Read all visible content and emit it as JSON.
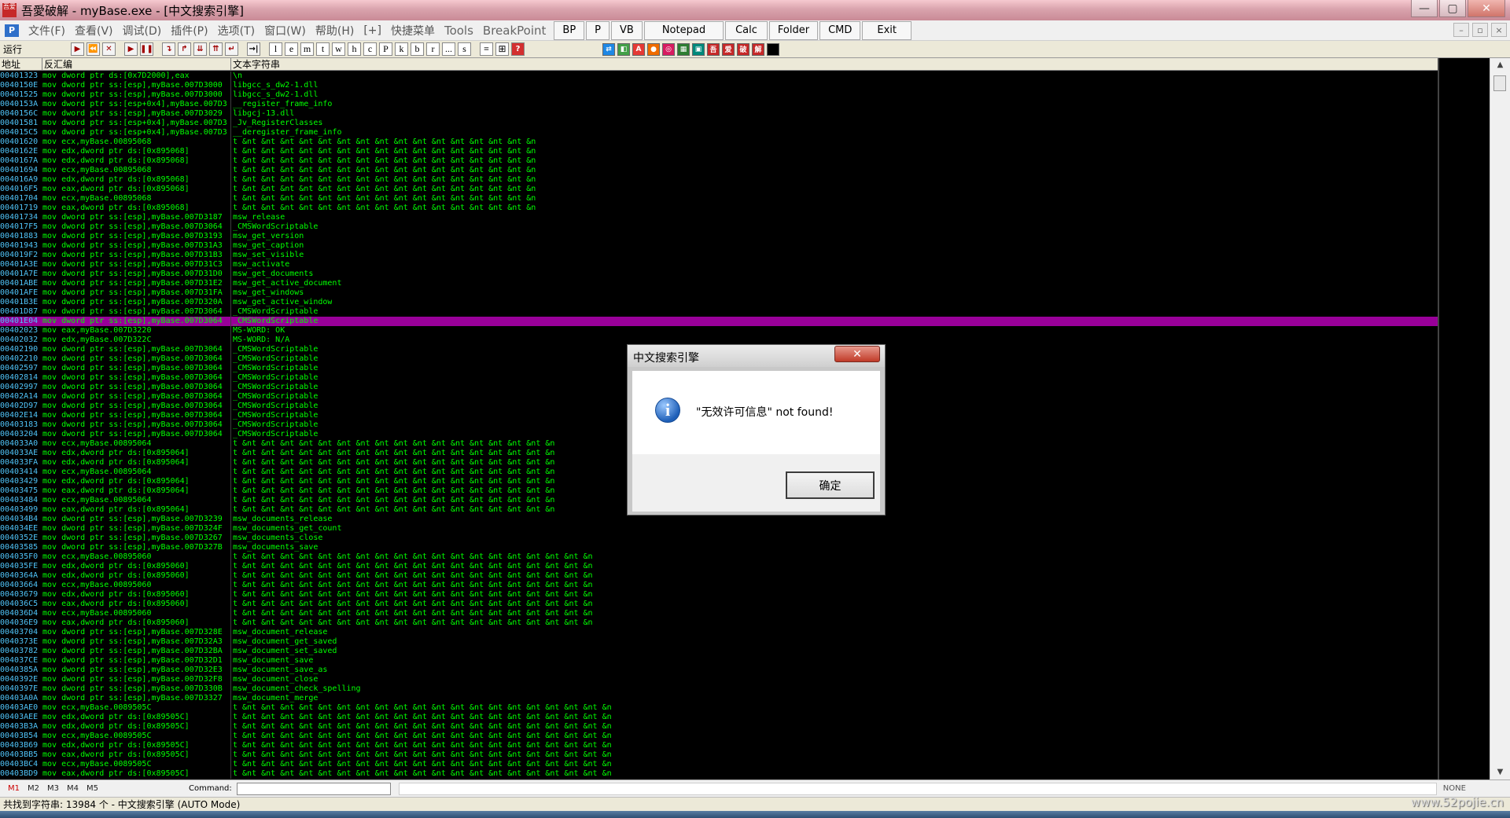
{
  "window": {
    "title": "吾愛破解 - myBase.exe - [中文搜索引擎]",
    "app_icon_text": "吾爱",
    "buttons": [
      "—",
      "▢",
      "✕"
    ]
  },
  "menu": {
    "logo": "P",
    "items": [
      "文件(F)",
      "查看(V)",
      "调试(D)",
      "插件(P)",
      "选项(T)",
      "窗口(W)",
      "帮助(H)",
      "[+]",
      "快捷菜单"
    ],
    "extra_items": [
      "Tools",
      "BreakPoint"
    ],
    "plugin_buttons": [
      "BP",
      "P",
      "VB",
      "Notepad",
      "Calc",
      "Folder",
      "CMD",
      "Exit"
    ],
    "mdi_buttons": [
      "–",
      "▫",
      "×"
    ]
  },
  "toolbar": {
    "status": "运行",
    "controls": [
      "▶",
      "⏪",
      "✕",
      "▶",
      "❚❚",
      "↴",
      "↱",
      "⇊",
      "⇈",
      "↵",
      "→|"
    ],
    "letters": [
      "l",
      "e",
      "m",
      "t",
      "w",
      "h",
      "c",
      "P",
      "k",
      "b",
      "r",
      "...",
      "s"
    ],
    "tools": [
      "≡",
      "⊞",
      "?"
    ],
    "plugin_icons": [
      {
        "label": "⇄",
        "color": "#1e88e5"
      },
      {
        "label": "◧",
        "color": "#43a047"
      },
      {
        "label": "A",
        "color": "#e53935"
      },
      {
        "label": "●",
        "color": "#ef6c00"
      },
      {
        "label": "◎",
        "color": "#d81b60"
      },
      {
        "label": "▦",
        "color": "#2e7d32"
      },
      {
        "label": "▣",
        "color": "#00897b"
      },
      {
        "label": "吾",
        "color": "#c62828"
      },
      {
        "label": "爱",
        "color": "#c62828"
      },
      {
        "label": "破",
        "color": "#c62828"
      },
      {
        "label": "解",
        "color": "#c62828"
      },
      {
        "label": "",
        "color": "#000000"
      }
    ]
  },
  "table": {
    "headers": [
      "地址",
      "反汇编",
      "文本字符串"
    ],
    "selected_index": 26,
    "rows": [
      {
        "addr": "00401323",
        "asm": "mov dword ptr ds:[0x7D2000],eax",
        "str": "\\n"
      },
      {
        "addr": "0040150E",
        "asm": "mov dword ptr ss:[esp],myBase.007D3000",
        "str": "libgcc_s_dw2-1.dll"
      },
      {
        "addr": "00401525",
        "asm": "mov dword ptr ss:[esp],myBase.007D3000",
        "str": "libgcc_s_dw2-1.dll"
      },
      {
        "addr": "0040153A",
        "asm": "mov dword ptr ss:[esp+0x4],myBase.007D3",
        "str": "__register_frame_info"
      },
      {
        "addr": "0040156C",
        "asm": "mov dword ptr ss:[esp],myBase.007D3029",
        "str": "libgcj-13.dll"
      },
      {
        "addr": "00401581",
        "asm": "mov dword ptr ss:[esp+0x4],myBase.007D3",
        "str": "_Jv_RegisterClasses"
      },
      {
        "addr": "004015C5",
        "asm": "mov dword ptr ss:[esp+0x4],myBase.007D3",
        "str": "__deregister_frame_info"
      },
      {
        "addr": "00401620",
        "asm": "mov ecx,myBase.00895068",
        "str": "t &nt &nt &nt &nt &nt &nt &nt &nt &nt &nt &nt &nt &nt &nt &nt &n"
      },
      {
        "addr": "0040162E",
        "asm": "mov edx,dword ptr ds:[0x895068]",
        "str": "t &nt &nt &nt &nt &nt &nt &nt &nt &nt &nt &nt &nt &nt &nt &nt &n"
      },
      {
        "addr": "0040167A",
        "asm": "mov edx,dword ptr ds:[0x895068]",
        "str": "t &nt &nt &nt &nt &nt &nt &nt &nt &nt &nt &nt &nt &nt &nt &nt &n"
      },
      {
        "addr": "00401694",
        "asm": "mov ecx,myBase.00895068",
        "str": "t &nt &nt &nt &nt &nt &nt &nt &nt &nt &nt &nt &nt &nt &nt &nt &n"
      },
      {
        "addr": "004016A9",
        "asm": "mov edx,dword ptr ds:[0x895068]",
        "str": "t &nt &nt &nt &nt &nt &nt &nt &nt &nt &nt &nt &nt &nt &nt &nt &n"
      },
      {
        "addr": "004016F5",
        "asm": "mov eax,dword ptr ds:[0x895068]",
        "str": "t &nt &nt &nt &nt &nt &nt &nt &nt &nt &nt &nt &nt &nt &nt &nt &n"
      },
      {
        "addr": "00401704",
        "asm": "mov ecx,myBase.00895068",
        "str": "t &nt &nt &nt &nt &nt &nt &nt &nt &nt &nt &nt &nt &nt &nt &nt &n"
      },
      {
        "addr": "00401719",
        "asm": "mov eax,dword ptr ds:[0x895068]",
        "str": "t &nt &nt &nt &nt &nt &nt &nt &nt &nt &nt &nt &nt &nt &nt &nt &n"
      },
      {
        "addr": "00401734",
        "asm": "mov dword ptr ss:[esp],myBase.007D3187",
        "str": "msw_release"
      },
      {
        "addr": "004017F5",
        "asm": "mov dword ptr ss:[esp],myBase.007D3064",
        "str": "_CMSWordScriptable"
      },
      {
        "addr": "00401883",
        "asm": "mov dword ptr ss:[esp],myBase.007D3193",
        "str": "msw_get_version"
      },
      {
        "addr": "00401943",
        "asm": "mov dword ptr ss:[esp],myBase.007D31A3",
        "str": "msw_get_caption"
      },
      {
        "addr": "004019F2",
        "asm": "mov dword ptr ss:[esp],myBase.007D31B3",
        "str": "msw_set_visible"
      },
      {
        "addr": "00401A3E",
        "asm": "mov dword ptr ss:[esp],myBase.007D31C3",
        "str": "msw_activate"
      },
      {
        "addr": "00401A7E",
        "asm": "mov dword ptr ss:[esp],myBase.007D31D0",
        "str": "msw_get_documents"
      },
      {
        "addr": "00401ABE",
        "asm": "mov dword ptr ss:[esp],myBase.007D31E2",
        "str": "msw_get_active_document"
      },
      {
        "addr": "00401AFE",
        "asm": "mov dword ptr ss:[esp],myBase.007D31FA",
        "str": "msw_get_windows"
      },
      {
        "addr": "00401B3E",
        "asm": "mov dword ptr ss:[esp],myBase.007D320A",
        "str": "msw_get_active_window"
      },
      {
        "addr": "00401D87",
        "asm": "mov dword ptr ss:[esp],myBase.007D3064",
        "str": "_CMSWordScriptable"
      },
      {
        "addr": "00401E04",
        "asm": "mov dword ptr ss:[esp],myBase.007D3064",
        "str": "_CMSWordScriptable"
      },
      {
        "addr": "00402023",
        "asm": "mov eax,myBase.007D3220",
        "str": "MS-WORD: OK"
      },
      {
        "addr": "00402032",
        "asm": "mov edx,myBase.007D322C",
        "str": "MS-WORD: N/A"
      },
      {
        "addr": "00402190",
        "asm": "mov dword ptr ss:[esp],myBase.007D3064",
        "str": "_CMSWordScriptable"
      },
      {
        "addr": "00402210",
        "asm": "mov dword ptr ss:[esp],myBase.007D3064",
        "str": "_CMSWordScriptable"
      },
      {
        "addr": "00402597",
        "asm": "mov dword ptr ss:[esp],myBase.007D3064",
        "str": "_CMSWordScriptable"
      },
      {
        "addr": "00402814",
        "asm": "mov dword ptr ss:[esp],myBase.007D3064",
        "str": "_CMSWordScriptable"
      },
      {
        "addr": "00402997",
        "asm": "mov dword ptr ss:[esp],myBase.007D3064",
        "str": "_CMSWordScriptable"
      },
      {
        "addr": "00402A14",
        "asm": "mov dword ptr ss:[esp],myBase.007D3064",
        "str": "_CMSWordScriptable"
      },
      {
        "addr": "00402D97",
        "asm": "mov dword ptr ss:[esp],myBase.007D3064",
        "str": "_CMSWordScriptable"
      },
      {
        "addr": "00402E14",
        "asm": "mov dword ptr ss:[esp],myBase.007D3064",
        "str": "_CMSWordScriptable"
      },
      {
        "addr": "00403183",
        "asm": "mov dword ptr ss:[esp],myBase.007D3064",
        "str": "_CMSWordScriptable"
      },
      {
        "addr": "00403204",
        "asm": "mov dword ptr ss:[esp],myBase.007D3064",
        "str": "_CMSWordScriptable"
      },
      {
        "addr": "004033A0",
        "asm": "mov ecx,myBase.00895064",
        "str": "t &nt &nt &nt &nt &nt &nt &nt &nt &nt &nt &nt &nt &nt &nt &nt &nt &n"
      },
      {
        "addr": "004033AE",
        "asm": "mov edx,dword ptr ds:[0x895064]",
        "str": "t &nt &nt &nt &nt &nt &nt &nt &nt &nt &nt &nt &nt &nt &nt &nt &nt &n"
      },
      {
        "addr": "004033FA",
        "asm": "mov edx,dword ptr ds:[0x895064]",
        "str": "t &nt &nt &nt &nt &nt &nt &nt &nt &nt &nt &nt &nt &nt &nt &nt &nt &n"
      },
      {
        "addr": "00403414",
        "asm": "mov ecx,myBase.00895064",
        "str": "t &nt &nt &nt &nt &nt &nt &nt &nt &nt &nt &nt &nt &nt &nt &nt &nt &n"
      },
      {
        "addr": "00403429",
        "asm": "mov edx,dword ptr ds:[0x895064]",
        "str": "t &nt &nt &nt &nt &nt &nt &nt &nt &nt &nt &nt &nt &nt &nt &nt &nt &n"
      },
      {
        "addr": "00403475",
        "asm": "mov eax,dword ptr ds:[0x895064]",
        "str": "t &nt &nt &nt &nt &nt &nt &nt &nt &nt &nt &nt &nt &nt &nt &nt &nt &n"
      },
      {
        "addr": "00403484",
        "asm": "mov ecx,myBase.00895064",
        "str": "t &nt &nt &nt &nt &nt &nt &nt &nt &nt &nt &nt &nt &nt &nt &nt &nt &n"
      },
      {
        "addr": "00403499",
        "asm": "mov eax,dword ptr ds:[0x895064]",
        "str": "t &nt &nt &nt &nt &nt &nt &nt &nt &nt &nt &nt &nt &nt &nt &nt &nt &n"
      },
      {
        "addr": "004034B4",
        "asm": "mov dword ptr ss:[esp],myBase.007D3239",
        "str": "msw_documents_release"
      },
      {
        "addr": "004034EE",
        "asm": "mov dword ptr ss:[esp],myBase.007D324F",
        "str": "msw_documents_get_count"
      },
      {
        "addr": "0040352E",
        "asm": "mov dword ptr ss:[esp],myBase.007D3267",
        "str": "msw_documents_close"
      },
      {
        "addr": "00403585",
        "asm": "mov dword ptr ss:[esp],myBase.007D327B",
        "str": "msw_documents_save"
      },
      {
        "addr": "004035F0",
        "asm": "mov ecx,myBase.00895060",
        "str": "t &nt &nt &nt &nt &nt &nt &nt &nt &nt &nt &nt &nt &nt &nt &nt &nt &nt &nt &n"
      },
      {
        "addr": "004035FE",
        "asm": "mov edx,dword ptr ds:[0x895060]",
        "str": "t &nt &nt &nt &nt &nt &nt &nt &nt &nt &nt &nt &nt &nt &nt &nt &nt &nt &nt &n"
      },
      {
        "addr": "0040364A",
        "asm": "mov edx,dword ptr ds:[0x895060]",
        "str": "t &nt &nt &nt &nt &nt &nt &nt &nt &nt &nt &nt &nt &nt &nt &nt &nt &nt &nt &n"
      },
      {
        "addr": "00403664",
        "asm": "mov ecx,myBase.00895060",
        "str": "t &nt &nt &nt &nt &nt &nt &nt &nt &nt &nt &nt &nt &nt &nt &nt &nt &nt &nt &n"
      },
      {
        "addr": "00403679",
        "asm": "mov edx,dword ptr ds:[0x895060]",
        "str": "t &nt &nt &nt &nt &nt &nt &nt &nt &nt &nt &nt &nt &nt &nt &nt &nt &nt &nt &n"
      },
      {
        "addr": "004036C5",
        "asm": "mov eax,dword ptr ds:[0x895060]",
        "str": "t &nt &nt &nt &nt &nt &nt &nt &nt &nt &nt &nt &nt &nt &nt &nt &nt &nt &nt &n"
      },
      {
        "addr": "004036D4",
        "asm": "mov ecx,myBase.00895060",
        "str": "t &nt &nt &nt &nt &nt &nt &nt &nt &nt &nt &nt &nt &nt &nt &nt &nt &nt &nt &n"
      },
      {
        "addr": "004036E9",
        "asm": "mov eax,dword ptr ds:[0x895060]",
        "str": "t &nt &nt &nt &nt &nt &nt &nt &nt &nt &nt &nt &nt &nt &nt &nt &nt &nt &nt &n"
      },
      {
        "addr": "00403704",
        "asm": "mov dword ptr ss:[esp],myBase.007D328E",
        "str": "msw_document_release"
      },
      {
        "addr": "0040373E",
        "asm": "mov dword ptr ss:[esp],myBase.007D32A3",
        "str": "msw_document_get_saved"
      },
      {
        "addr": "00403782",
        "asm": "mov dword ptr ss:[esp],myBase.007D32BA",
        "str": "msw_document_set_saved"
      },
      {
        "addr": "004037CE",
        "asm": "mov dword ptr ss:[esp],myBase.007D32D1",
        "str": "msw_document_save"
      },
      {
        "addr": "0040385A",
        "asm": "mov dword ptr ss:[esp],myBase.007D32E3",
        "str": "msw_document_save_as"
      },
      {
        "addr": "0040392E",
        "asm": "mov dword ptr ss:[esp],myBase.007D32F8",
        "str": "msw_document_close"
      },
      {
        "addr": "0040397E",
        "asm": "mov dword ptr ss:[esp],myBase.007D330B",
        "str": "msw_document_check_spelling"
      },
      {
        "addr": "00403A0A",
        "asm": "mov dword ptr ss:[esp],myBase.007D3327",
        "str": "msw_document_merge"
      },
      {
        "addr": "00403AE0",
        "asm": "mov ecx,myBase.0089505C",
        "str": "t &nt &nt &nt &nt &nt &nt &nt &nt &nt &nt &nt &nt &nt &nt &nt &nt &nt &nt &nt &n"
      },
      {
        "addr": "00403AEE",
        "asm": "mov edx,dword ptr ds:[0x89505C]",
        "str": "t &nt &nt &nt &nt &nt &nt &nt &nt &nt &nt &nt &nt &nt &nt &nt &nt &nt &nt &nt &n"
      },
      {
        "addr": "00403B3A",
        "asm": "mov edx,dword ptr ds:[0x89505C]",
        "str": "t &nt &nt &nt &nt &nt &nt &nt &nt &nt &nt &nt &nt &nt &nt &nt &nt &nt &nt &nt &n"
      },
      {
        "addr": "00403B54",
        "asm": "mov ecx,myBase.0089505C",
        "str": "t &nt &nt &nt &nt &nt &nt &nt &nt &nt &nt &nt &nt &nt &nt &nt &nt &nt &nt &nt &n"
      },
      {
        "addr": "00403B69",
        "asm": "mov edx,dword ptr ds:[0x89505C]",
        "str": "t &nt &nt &nt &nt &nt &nt &nt &nt &nt &nt &nt &nt &nt &nt &nt &nt &nt &nt &nt &n"
      },
      {
        "addr": "00403BB5",
        "asm": "mov eax,dword ptr ds:[0x89505C]",
        "str": "t &nt &nt &nt &nt &nt &nt &nt &nt &nt &nt &nt &nt &nt &nt &nt &nt &nt &nt &nt &n"
      },
      {
        "addr": "00403BC4",
        "asm": "mov ecx,myBase.0089505C",
        "str": "t &nt &nt &nt &nt &nt &nt &nt &nt &nt &nt &nt &nt &nt &nt &nt &nt &nt &nt &nt &n"
      },
      {
        "addr": "00403BD9",
        "asm": "mov eax,dword ptr ds:[0x89505C]",
        "str": "t &nt &nt &nt &nt &nt &nt &nt &nt &nt &nt &nt &nt &nt &nt &nt &nt &nt &nt &nt &n"
      }
    ]
  },
  "dialog": {
    "title": "中文搜索引擎",
    "close_glyph": "✕",
    "icon_glyph": "i",
    "message": "\"无效许可信息\" not found!",
    "ok_label": "确定"
  },
  "command_bar": {
    "tabs": [
      "M1",
      "M2",
      "M3",
      "M4",
      "M5"
    ],
    "active_tab": "M1",
    "label": "Command:",
    "value": "",
    "dropdown_glyph": "▼",
    "right_text": "NONE"
  },
  "status": {
    "text": "共找到字符串: 13984 个  -  中文搜索引擎 (AUTO Mode)"
  },
  "watermark": "www.52pojie.cn"
}
